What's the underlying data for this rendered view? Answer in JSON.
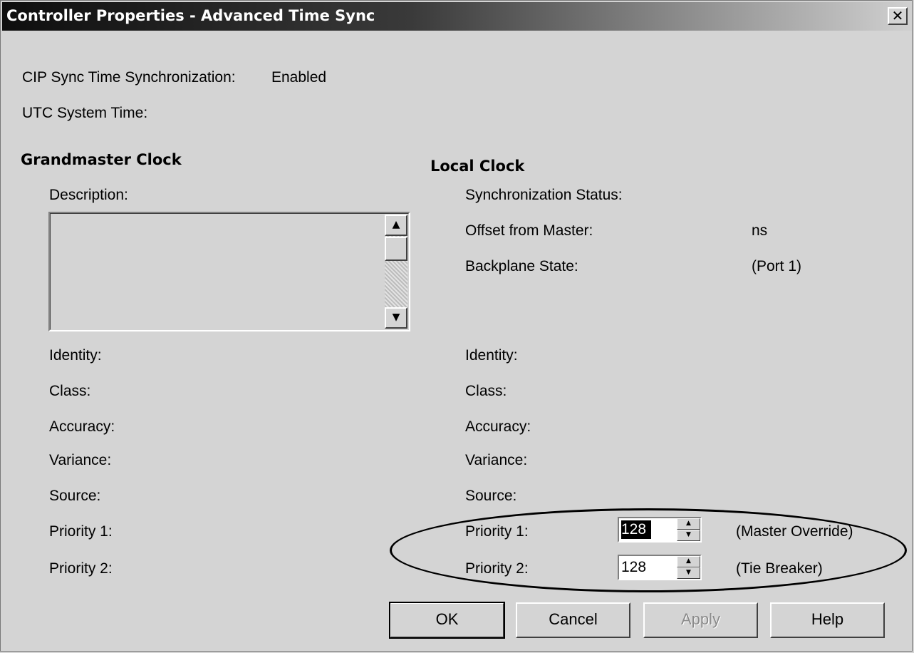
{
  "window": {
    "title": "Controller Properties - Advanced Time Sync",
    "close_glyph": "✕"
  },
  "cip_sync": {
    "label": "CIP Sync Time Synchronization:",
    "value": "Enabled"
  },
  "utc": {
    "label": "UTC System Time:"
  },
  "grandmaster": {
    "heading": "Grandmaster Clock",
    "description_label": "Description:",
    "description_value": "",
    "fields": {
      "identity": "Identity:",
      "class": "Class:",
      "accuracy": "Accuracy:",
      "variance": "Variance:",
      "source": "Source:",
      "priority1": "Priority 1:",
      "priority2": "Priority 2:"
    }
  },
  "local": {
    "heading": "Local Clock",
    "sync_status": "Synchronization Status:",
    "offset_label": "Offset from Master:",
    "offset_unit": "ns",
    "backplane_label": "Backplane State:",
    "backplane_value": "(Port 1)",
    "fields": {
      "identity": "Identity:",
      "class": "Class:",
      "accuracy": "Accuracy:",
      "variance": "Variance:",
      "source": "Source:",
      "priority1": "Priority 1:",
      "priority2": "Priority 2:"
    },
    "priority1_value": "128",
    "priority1_note": "(Master Override)",
    "priority2_value": "128",
    "priority2_note": "(Tie Breaker)"
  },
  "scroll": {
    "up": "▲",
    "down": "▼"
  },
  "spin": {
    "up": "▲",
    "down": "▼"
  },
  "buttons": {
    "ok": "OK",
    "cancel": "Cancel",
    "apply": "Apply",
    "help": "Help"
  },
  "colors": {
    "face": "#d4d4d4",
    "annotation_ellipse": "#000000"
  }
}
